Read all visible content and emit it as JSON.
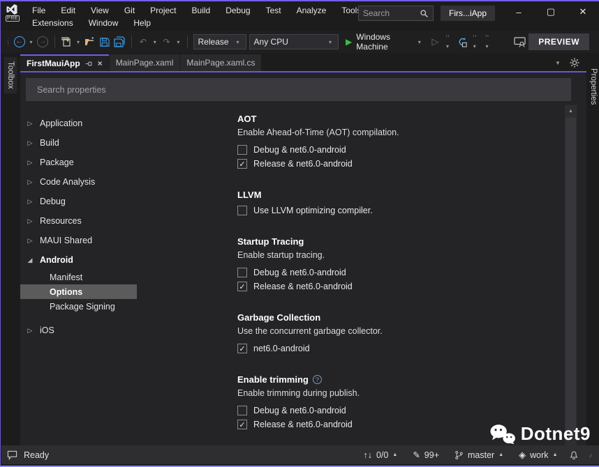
{
  "colors": {
    "accent": "#7160e8",
    "save_blue": "#3a96dd",
    "run_green": "#3ebe3e",
    "folder_yellow": "#dcb67a"
  },
  "titlebar": {
    "menu_row1": [
      "File",
      "Edit",
      "View",
      "Git",
      "Project",
      "Build",
      "Debug",
      "Test",
      "Analyze",
      "Tools"
    ],
    "menu_row2": [
      "Extensions",
      "Window",
      "Help"
    ],
    "search_placeholder": "Search",
    "window_title": "Firs...iApp",
    "logo_badge": "PRE",
    "controls": {
      "minimize": "–",
      "maximize": "▢",
      "close": "✕"
    }
  },
  "toolbar": {
    "configuration": "Release",
    "platform": "Any CPU",
    "run_target": "Windows Machine",
    "preview_label": "PREVIEW"
  },
  "tabstrip": {
    "tabs": [
      {
        "label": "FirstMauiApp",
        "active": true
      },
      {
        "label": "MainPage.xaml",
        "active": false
      },
      {
        "label": "MainPage.xaml.cs",
        "active": false
      }
    ]
  },
  "strips": {
    "left": "Toolbox",
    "right": "Properties"
  },
  "properties_page": {
    "search_placeholder": "Search properties",
    "tree": [
      {
        "label": "Application",
        "expanded": false
      },
      {
        "label": "Build",
        "expanded": false
      },
      {
        "label": "Package",
        "expanded": false
      },
      {
        "label": "Code Analysis",
        "expanded": false
      },
      {
        "label": "Debug",
        "expanded": false
      },
      {
        "label": "Resources",
        "expanded": false
      },
      {
        "label": "MAUI Shared",
        "expanded": false
      },
      {
        "label": "Android",
        "expanded": true,
        "children": [
          {
            "label": "Manifest",
            "selected": false
          },
          {
            "label": "Options",
            "selected": true
          },
          {
            "label": "Package Signing",
            "selected": false
          }
        ]
      },
      {
        "label": "iOS",
        "expanded": false
      }
    ],
    "sections": [
      {
        "title": "AOT",
        "description": "Enable Ahead-of-Time (AOT) compilation.",
        "options": [
          {
            "label": "Debug & net6.0-android",
            "checked": false
          },
          {
            "label": "Release & net6.0-android",
            "checked": true
          }
        ]
      },
      {
        "title": "LLVM",
        "options": [
          {
            "label": "Use LLVM optimizing compiler.",
            "checked": false
          }
        ]
      },
      {
        "title": "Startup Tracing",
        "description": "Enable startup tracing.",
        "options": [
          {
            "label": "Debug & net6.0-android",
            "checked": false
          },
          {
            "label": "Release & net6.0-android",
            "checked": true
          }
        ]
      },
      {
        "title": "Garbage Collection",
        "description": "Use the concurrent garbage collector.",
        "options": [
          {
            "label": "net6.0-android",
            "checked": true
          }
        ]
      },
      {
        "title": "Enable trimming",
        "description": "Enable trimming during publish.",
        "has_help": true,
        "options": [
          {
            "label": "Debug & net6.0-android",
            "checked": false
          },
          {
            "label": "Release & net6.0-android",
            "checked": true
          }
        ]
      }
    ]
  },
  "statusbar": {
    "message": "Ready",
    "sync_arrows": "↑↓",
    "sync_count": "0/0",
    "edits_badge": "99+",
    "branch": "master",
    "repo": "work"
  },
  "watermark": {
    "text": "Dotnet9"
  }
}
